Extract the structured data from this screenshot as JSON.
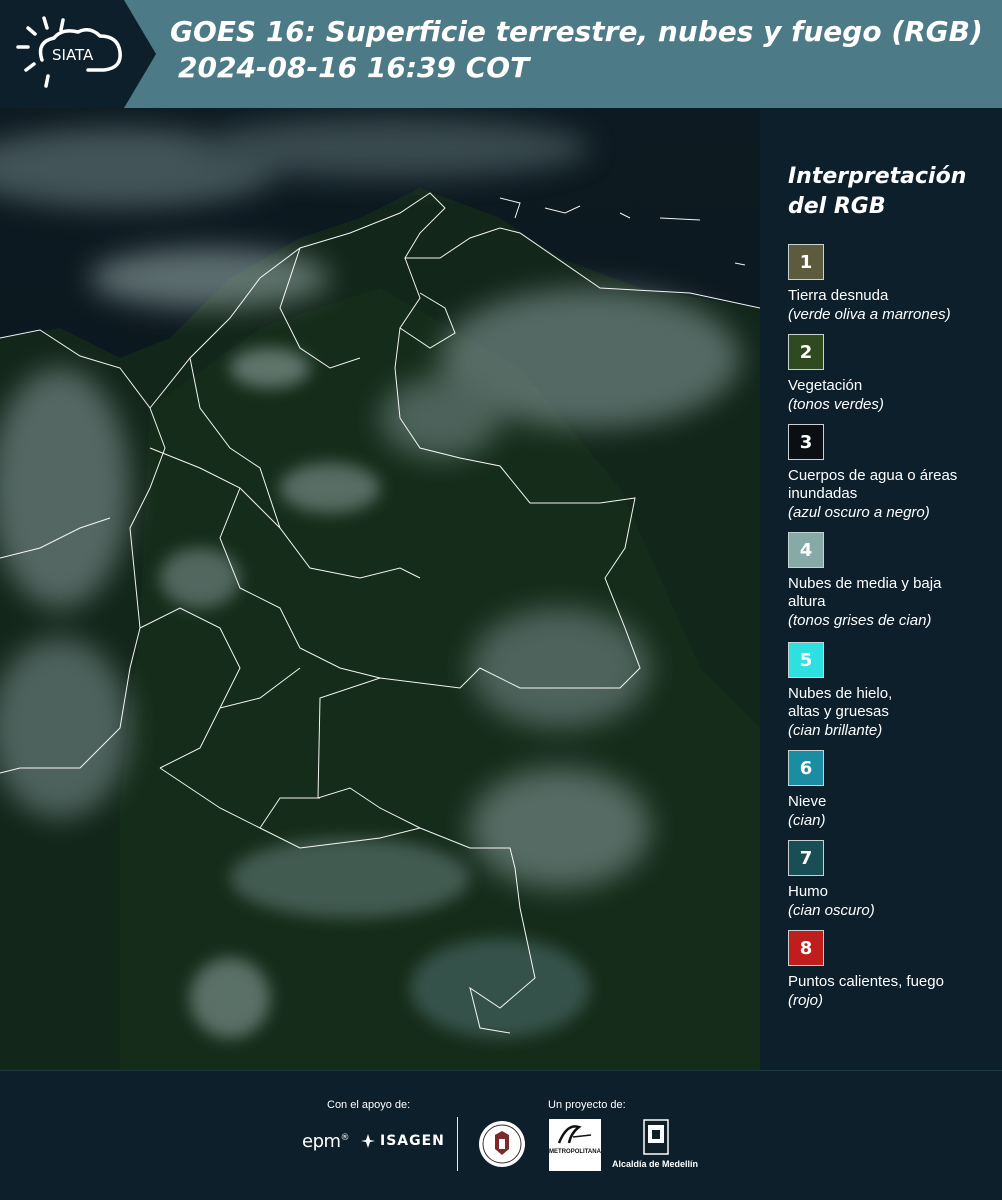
{
  "header": {
    "logo_text": "SIATA",
    "title_line1": "GOES 16: Superficie terrestre, nubes y fuego (RGB)",
    "title_line2": "2024-08-16 16:39 COT"
  },
  "legend": {
    "title": "Interpretación del RGB",
    "items": [
      {
        "number": "1",
        "label": "Tierra desnuda",
        "desc": "(verde oliva a marrones)",
        "color": "#5c5b3d"
      },
      {
        "number": "2",
        "label": "Vegetación",
        "desc": "(tonos verdes)",
        "color": "#2f4a1e"
      },
      {
        "number": "3",
        "label": "Cuerpos de agua o áreas inundadas",
        "desc": "(azul oscuro a negro)",
        "color": "#0b0f14"
      },
      {
        "number": "4",
        "label": "Nubes de media y baja altura",
        "desc": "(tonos grises de cian)",
        "color": "#87aaa8"
      },
      {
        "number": "5",
        "label": "Nubes de hielo, altas y gruesas",
        "desc": "(cian brillante)",
        "color": "#2fe0e0"
      },
      {
        "number": "6",
        "label": "Nieve",
        "desc": "(cian)",
        "color": "#1b8da3"
      },
      {
        "number": "7",
        "label": "Humo",
        "desc": "(cian oscuro)",
        "color": "#1a4e55"
      },
      {
        "number": "8",
        "label": "Puntos calientes, fuego",
        "desc": "(rojo)",
        "color": "#c01d1d"
      }
    ]
  },
  "footer": {
    "support_label": "Con el apoyo de:",
    "project_label": "Un proyecto de:",
    "epm": "epm",
    "isagen": "ISAGEN",
    "metro_text": "METROPOLITANA",
    "alcaldia": "Alcaldía de Medellín"
  }
}
